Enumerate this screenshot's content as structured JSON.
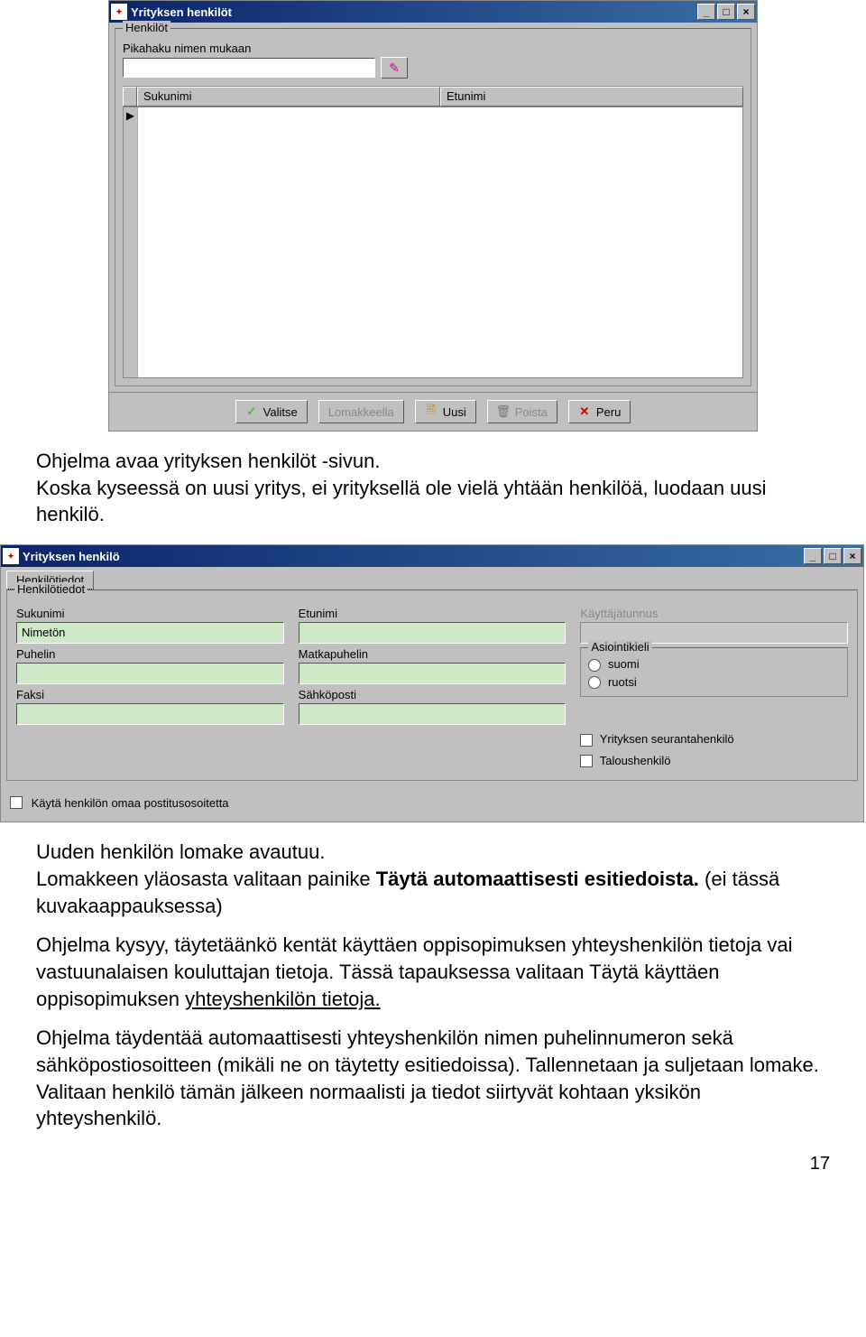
{
  "window1": {
    "title": "Yrityksen henkilöt",
    "group_label": "Henkilöt",
    "search_label": "Pikahaku nimen mukaan",
    "search_value": "",
    "columns": {
      "c1": "Sukunimi",
      "c2": "Etunimi"
    },
    "buttons": {
      "select": "Valitse",
      "form": "Lomakkeella",
      "new": "Uusi",
      "delete": "Poista",
      "cancel": "Peru"
    }
  },
  "text1": {
    "p1": "Ohjelma avaa yrityksen henkilöt -sivun.",
    "p2": "Koska kyseessä on uusi yritys, ei yrityksellä ole vielä yhtään henkilöä, luodaan uusi henkilö."
  },
  "window2": {
    "title": "Yrityksen henkilö",
    "tab": "Henkilötiedot",
    "group_label": "Henkilötiedot",
    "lastname_label": "Sukunimi",
    "lastname_value": "Nimetön",
    "firstname_label": "Etunimi",
    "phone_label": "Puhelin",
    "mobile_label": "Matkapuhelin",
    "fax_label": "Faksi",
    "email_label": "Sähköposti",
    "userid_label": "Käyttäjätunnus",
    "lang_group": "Asiointikieli",
    "lang_fi": "suomi",
    "lang_sv": "ruotsi",
    "tracking_label": "Yrityksen seurantahenkilö",
    "finance_label": "Taloushenkilö",
    "ownaddr_label": "Käytä henkilön omaa postitusosoitetta"
  },
  "text2": {
    "p1a": "Uuden henkilön lomake avautuu.",
    "p1b": "Lomakkeen yläosasta valitaan painike ",
    "p1c": "Täytä automaattisesti esitiedoista.",
    "p1d": " (ei tässä kuvakaappauksessa)",
    "p2a": "Ohjelma kysyy, täytetäänkö kentät käyttäen oppisopimuksen yhteyshenkilön tietoja vai vastuunalaisen kouluttajan tietoja. Tässä tapauksessa valitaan Täytä käyttäen oppisopimuksen ",
    "p2b": "yhteyshenkilön tietoja.",
    "p3": "Ohjelma täydentää automaattisesti yhteyshenkilön nimen puhelinnumeron sekä sähköpostiosoitteen (mikäli ne on täytetty esitiedoissa). Tallennetaan ja suljetaan lomake. Valitaan henkilö tämän jälkeen normaalisti ja tiedot siirtyvät kohtaan yksikön yhteyshenkilö."
  },
  "page_number": "17"
}
